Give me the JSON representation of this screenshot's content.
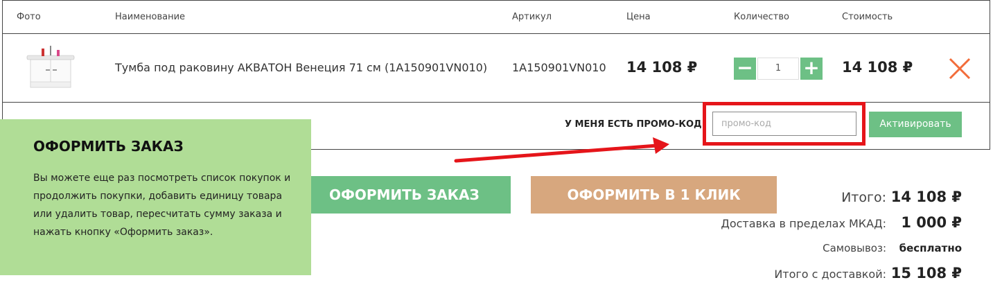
{
  "table": {
    "headers": {
      "photo": "Фото",
      "name": "Наименование",
      "sku": "Артикул",
      "price": "Цена",
      "qty": "Количество",
      "cost": "Стоимость"
    },
    "rows": [
      {
        "name": "Тумба под раковину АКВАТОН Венеция 71 см (1A150901VN010)",
        "sku": "1A150901VN010",
        "price": "14 108 ₽",
        "qty": "1",
        "cost": "14 108 ₽",
        "minus": "−",
        "plus": "+"
      }
    ]
  },
  "promo": {
    "label": "У МЕНЯ ЕСТЬ ПРОМО-КОД",
    "placeholder": "промо-код",
    "activate": "Активировать"
  },
  "tooltip": {
    "title": "ОФОРМИТЬ ЗАКАЗ",
    "text": "Вы можете еще раз посмотреть список покупок и продолжить покупки, добавить единицу товара или удалить товар, пересчитать сумму заказа и нажать кнопку «Оформить заказ»."
  },
  "actions": {
    "checkout": "ОФОРМИТЬ ЗАКАЗ",
    "one_click": "ОФОРМИТЬ В 1 КЛИК"
  },
  "totals": {
    "subtotal_label": "Итого:",
    "subtotal": "14 108 ₽",
    "delivery_label": "Доставка в пределах МКАД:",
    "delivery": "1 000 ₽",
    "pickup_label": "Самовывоз:",
    "pickup": "бесплатно",
    "grand_label": "Итого с доставкой:",
    "grand": "15 108 ₽"
  },
  "colors": {
    "accent_green": "#6dc085",
    "tooltip_green": "#b0dd96",
    "one_click_tan": "#d7a77e",
    "highlight_red": "#e5151a",
    "remove_orange": "#f26c3a"
  }
}
